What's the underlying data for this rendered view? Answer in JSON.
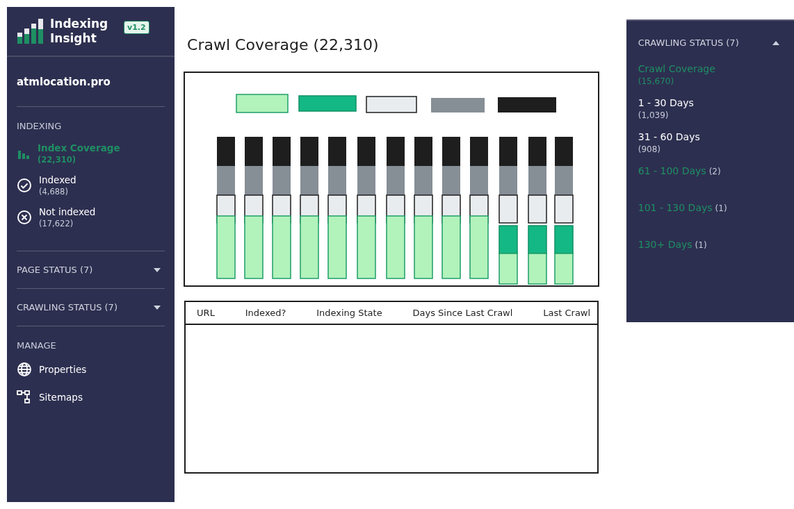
{
  "brand": {
    "name": "Indexing Insight",
    "version": "v1.2"
  },
  "property": "atmlocation.pro",
  "sidebar": {
    "sections": [
      {
        "heading": "INDEXING",
        "items": [
          {
            "kind": "bars",
            "label": "Index Coverage",
            "count": "(22,310)",
            "selected": true
          },
          {
            "kind": "check",
            "label": "Indexed",
            "count": "(4,688)",
            "selected": false
          },
          {
            "kind": "cross",
            "label": "Not indexed",
            "count": "(17,622)",
            "selected": false
          }
        ]
      }
    ],
    "collapsibles": [
      {
        "label": "PAGE STATUS (7)",
        "expanded": false
      },
      {
        "label": "CRAWLING STATUS (7)",
        "expanded": false
      }
    ],
    "manage": {
      "heading": "MANAGE",
      "items": [
        {
          "kind": "globe",
          "label": "Properties"
        },
        {
          "kind": "sitemap",
          "label": "Sitemaps"
        }
      ]
    }
  },
  "main": {
    "title": "Crawl Coverage (22,310)",
    "table": {
      "columns": [
        "URL",
        "Indexed?",
        "Indexing State",
        "Days Since Last Crawl",
        "Last Crawl"
      ]
    }
  },
  "crawl_panel": {
    "label": "CRAWLING STATUS (7)",
    "expanded": true,
    "items": [
      {
        "kind": "stacked",
        "label": "Crawl Coverage",
        "count": "(15,670)",
        "selected": true
      },
      {
        "kind": "stacked",
        "label": "1 - 30 Days",
        "count": "(1,039)",
        "selected": false
      },
      {
        "kind": "stacked",
        "label": "31 - 60 Days",
        "count": "(908)",
        "selected": false
      },
      {
        "kind": "inline",
        "label": "61 - 100 Days",
        "count": "(2)",
        "selected": false
      },
      {
        "kind": "inline",
        "label": "101 - 130 Days",
        "count": "(1)",
        "selected": false
      },
      {
        "kind": "inline",
        "label": "130+ Days",
        "count": "(1)",
        "selected": false
      }
    ]
  }
}
